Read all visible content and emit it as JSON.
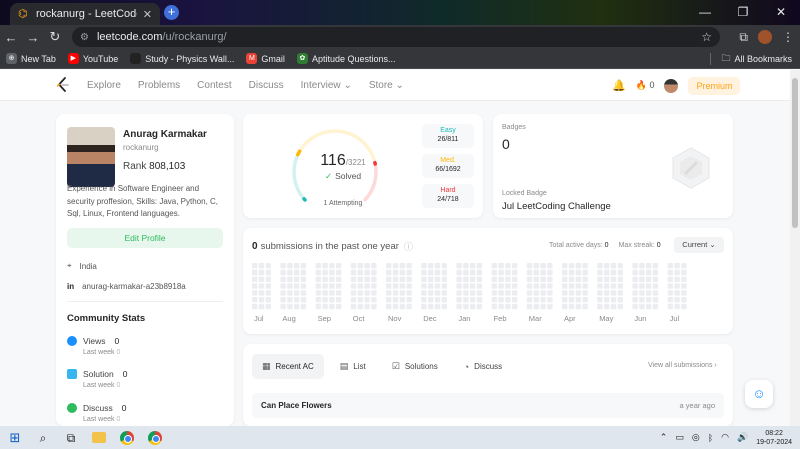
{
  "browser": {
    "tab_title": "rockanurg - LeetCode Profile",
    "url_host": "leetcode.com",
    "url_path": "/u/rockanurg/",
    "bookmarks": [
      {
        "label": "New Tab",
        "icon": "newtab-icon",
        "color": "#e8eaed"
      },
      {
        "label": "YouTube",
        "icon": "youtube-icon",
        "color": "#ff0000"
      },
      {
        "label": "Study - Physics Wall...",
        "icon": "pw-icon",
        "color": "#222222"
      },
      {
        "label": "Gmail",
        "icon": "gmail-icon",
        "color": "#ea4335"
      },
      {
        "label": "Aptitude Questions...",
        "icon": "aptitude-icon",
        "color": "#2e7d32"
      }
    ],
    "all_bookmarks": "All Bookmarks"
  },
  "nav": {
    "items": [
      "Explore",
      "Problems",
      "Contest",
      "Discuss",
      "Interview",
      "Store"
    ],
    "streak": "0",
    "premium": "Premium"
  },
  "profile": {
    "name": "Anurag Karmakar",
    "handle": "rockanurg",
    "rank_label": "Rank",
    "rank_value": "808,103",
    "about": "Experience in Software Engineer and security proffesion, Skills: Java, Python, C, Sql, Linux, Frontend languages.",
    "edit_label": "Edit Profile",
    "location": "India",
    "linkedin": "anurag-karmakar-a23b8918a"
  },
  "community": {
    "title": "Community Stats",
    "stats": [
      {
        "label": "Views",
        "value": "0",
        "sub": "Last week",
        "sub_value": "0",
        "color": "#1a90ff"
      },
      {
        "label": "Solution",
        "value": "0",
        "sub": "Last week",
        "sub_value": "0",
        "color": "#36b5ef"
      },
      {
        "label": "Discuss",
        "value": "0",
        "sub": "Last week",
        "sub_value": "0",
        "color": "#2cbb5d"
      }
    ]
  },
  "solved": {
    "solved": "116",
    "total": "/3221",
    "label": "Solved",
    "attempting": "1 Attempting",
    "difficulty": [
      {
        "name": "Easy",
        "value": "26/811",
        "color": "#1cbaba",
        "solved": 26,
        "total": 811
      },
      {
        "name": "Med.",
        "value": "66/1692",
        "color": "#ffb700",
        "solved": 66,
        "total": 1692
      },
      {
        "name": "Hard",
        "value": "24/718",
        "color": "#f63737",
        "solved": 24,
        "total": 718
      }
    ]
  },
  "badges": {
    "title": "Badges",
    "count": "0",
    "locked_label": "Locked Badge",
    "locked_name": "Jul LeetCoding Challenge"
  },
  "submissions": {
    "count": "0",
    "text": "submissions in the past one year",
    "active_days_label": "Total active days:",
    "active_days": "0",
    "max_streak_label": "Max streak:",
    "max_streak": "0",
    "current": "Current",
    "months": [
      "Jul",
      "Aug",
      "Sep",
      "Oct",
      "Nov",
      "Dec",
      "Jan",
      "Feb",
      "Mar",
      "Apr",
      "May",
      "Jun",
      "Jul"
    ]
  },
  "recent": {
    "tabs": [
      {
        "label": "Recent AC",
        "icon": "recent-icon"
      },
      {
        "label": "List",
        "icon": "list-icon"
      },
      {
        "label": "Solutions",
        "icon": "solutions-icon"
      },
      {
        "label": "Discuss",
        "icon": "discuss-icon"
      }
    ],
    "view_all": "View all submissions",
    "items": [
      {
        "title": "Can Place Flowers",
        "time": "a year ago"
      }
    ]
  },
  "taskbar": {
    "time": "08:22",
    "date": "19-07-2024"
  }
}
